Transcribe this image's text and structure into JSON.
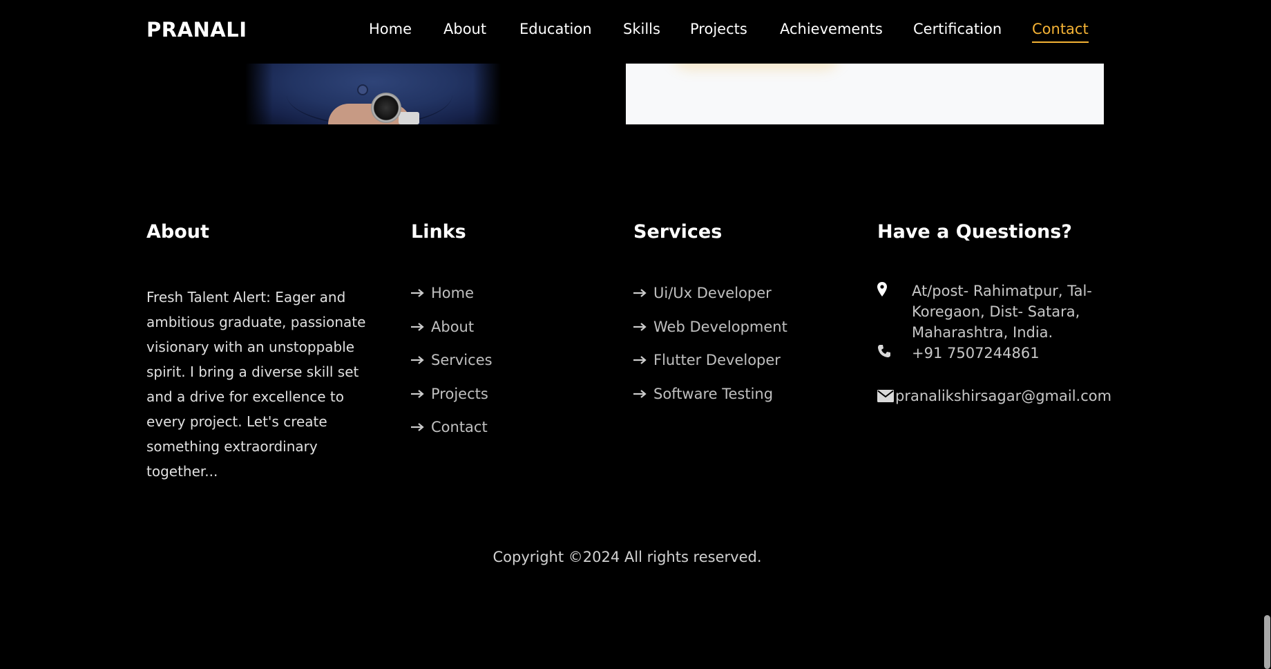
{
  "brand": "PRANALI",
  "nav": {
    "items": [
      {
        "label": "Home",
        "active": false
      },
      {
        "label": "About",
        "active": false
      },
      {
        "label": "Education",
        "active": false
      },
      {
        "label": "Skills",
        "active": false
      },
      {
        "label": "Projects",
        "active": false
      },
      {
        "label": "Achievements",
        "active": false
      },
      {
        "label": "Certification",
        "active": false
      },
      {
        "label": "Contact",
        "active": true
      }
    ],
    "active_color": "#f5b335"
  },
  "footer": {
    "about": {
      "heading": "About",
      "text": "Fresh Talent Alert: Eager and ambitious graduate, passionate visionary with an unstoppable spirit. I bring a diverse skill set and a drive for excellence to every project. Let's create something extraordinary together..."
    },
    "links": {
      "heading": "Links",
      "items": [
        "Home",
        "About",
        "Services",
        "Projects",
        "Contact"
      ]
    },
    "services": {
      "heading": "Services",
      "items": [
        "Ui/Ux Developer",
        "Web Development",
        "Flutter Developer",
        "Software Testing"
      ]
    },
    "questions": {
      "heading": "Have a Questions?",
      "address": "At/post- Rahimatpur, Tal-Koregaon, Dist- Satara, Maharashtra, India.",
      "phone": "+91 7507244861",
      "email": "pranalikshirsagar@gmail.com"
    },
    "copyright": "Copyright ©2024 All rights reserved."
  },
  "icons": {
    "arrow": "arrow-right-icon",
    "address": "map-marker-icon",
    "phone": "phone-icon",
    "email": "envelope-icon"
  },
  "colors": {
    "accent": "#f5b335",
    "background": "#000000"
  }
}
